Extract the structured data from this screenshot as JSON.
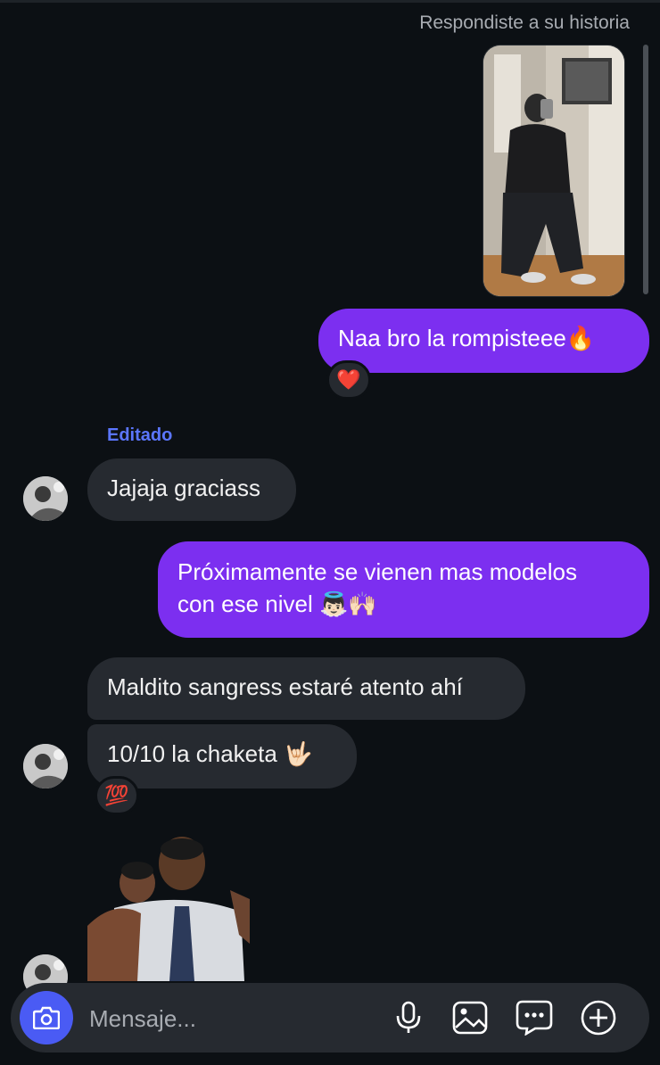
{
  "thread": {
    "story_reply_label": "Respondiste a su historia",
    "messages": [
      {
        "from": "me",
        "text": "Naa bro la rompisteee🔥",
        "reaction": "❤️"
      },
      {
        "from": "them",
        "label": "Editado",
        "text": "Jajaja graciass"
      },
      {
        "from": "me",
        "text_line1": "Próximamente se vienen mas modelos",
        "text_line2": "con ese nivel 👼🏻🙌🏻"
      },
      {
        "from": "them",
        "text": "Maldito sangress estaré atento ahí"
      },
      {
        "from": "them",
        "text": "10/10 la chaketa 🤟🏻",
        "reaction": "💯"
      }
    ]
  },
  "composer": {
    "placeholder": "Mensaje...",
    "icons": [
      "camera-icon",
      "microphone-icon",
      "image-icon",
      "sticker-chat-icon",
      "plus-circle-icon"
    ]
  },
  "colors": {
    "background": "#0c1014",
    "outgoing_bubble": "#7c2ff0",
    "incoming_bubble": "#262a30",
    "edited_label": "#5b76ff",
    "camera_button": "#4a5bf4"
  }
}
